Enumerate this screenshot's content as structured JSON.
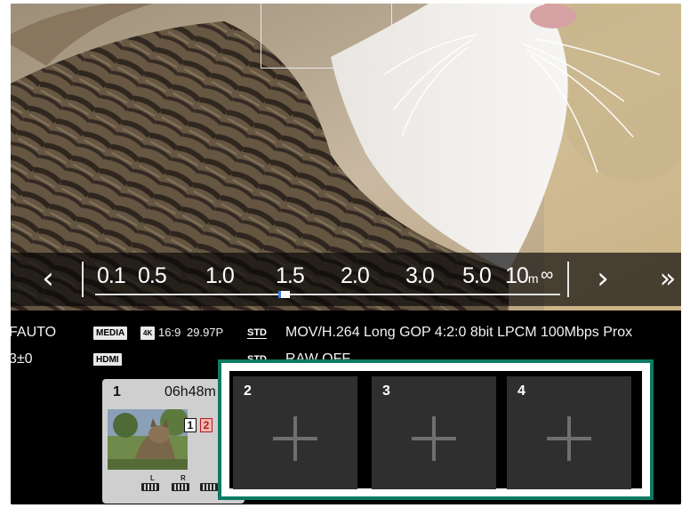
{
  "focus_bar": {
    "prev_icon": "chevron-left-icon",
    "next_icon": "chevron-right-icon",
    "skip_icon": "double-chevron-right-icon",
    "prev_glyph": "‹",
    "next_glyph": "›",
    "skip_glyph": "»",
    "ticks": [
      {
        "label": "0.1"
      },
      {
        "label": "0.5"
      },
      {
        "label": "1.0"
      },
      {
        "label": "1.5"
      },
      {
        "label": "2.0"
      },
      {
        "label": "3.0"
      },
      {
        "label": "5.0"
      },
      {
        "label": "10"
      }
    ],
    "unit": "m",
    "infinity": "∞",
    "current_value": "1.5",
    "accent_color": "#3f7fe0"
  },
  "info": {
    "row1": {
      "af_mode": "FAUTO",
      "media_tag": "MEDIA",
      "resolution_tag": "4K",
      "aspect": "16:9",
      "frame_rate": "29.97P",
      "std_tag": "STD",
      "format": "MOV/H.264 Long GOP 4:2:0 8bit LPCM 100Mbps Prox"
    },
    "row2": {
      "exposure": "3±0",
      "hdmi_tag": "HDMI",
      "std_tag": "STD",
      "raw": "RAW OFF"
    }
  },
  "slots": {
    "highlight_color": "#0e7a63",
    "slot1": {
      "number": "1",
      "time": "06h48m",
      "card1": "1",
      "card2": "2",
      "ch_left": "L",
      "ch_right": "R"
    },
    "empty": [
      {
        "number": "2",
        "icon": "plus-icon"
      },
      {
        "number": "3",
        "icon": "plus-icon"
      },
      {
        "number": "4",
        "icon": "plus-icon"
      }
    ]
  }
}
